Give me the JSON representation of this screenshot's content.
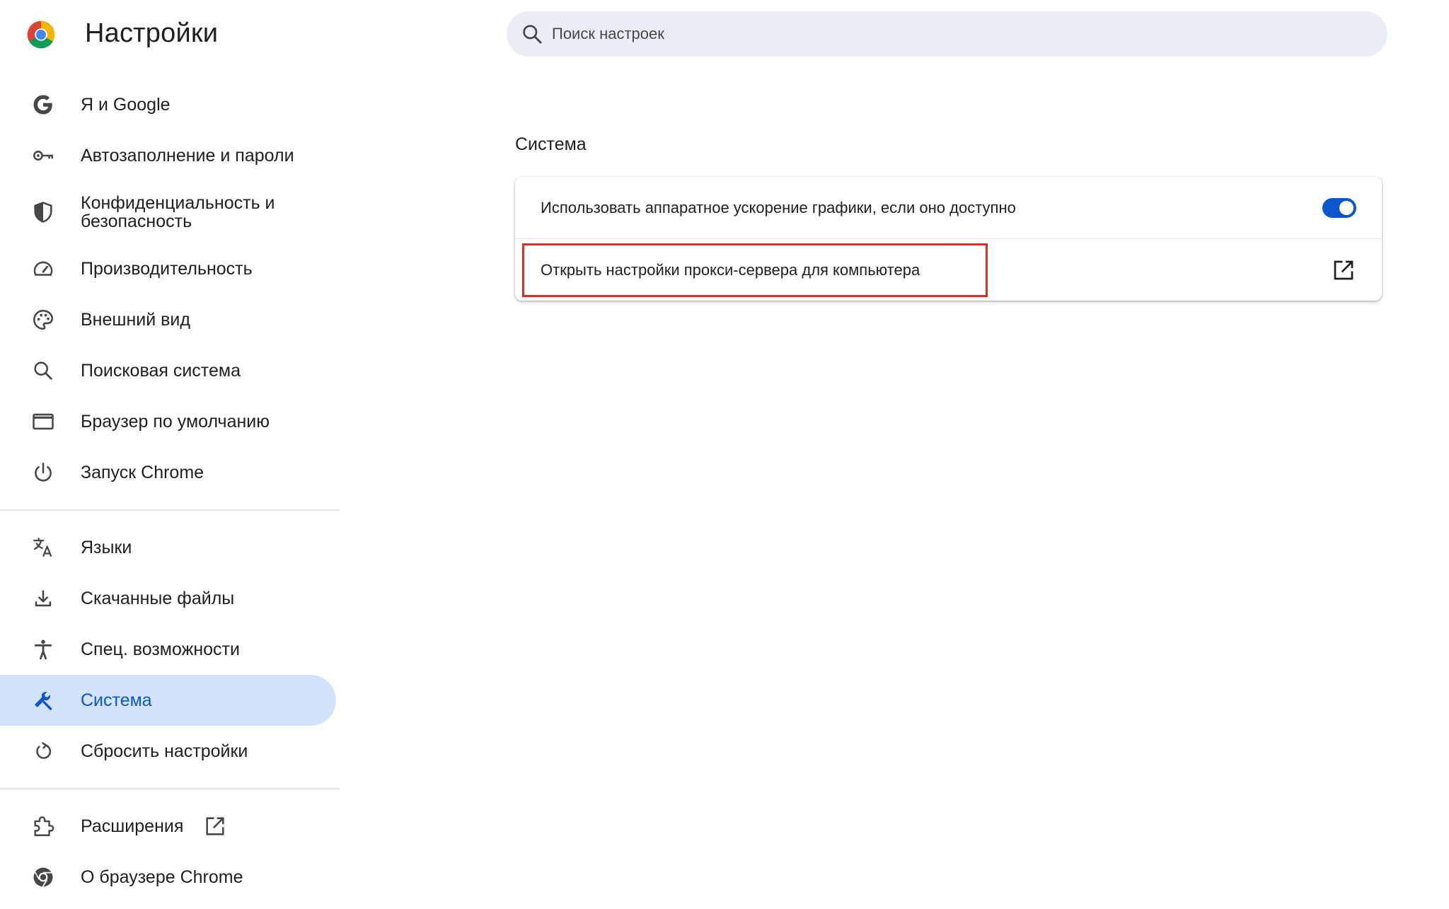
{
  "header": {
    "title": "Настройки",
    "search_placeholder": "Поиск настроек"
  },
  "sidebar": {
    "items": [
      {
        "label": "Я и Google",
        "icon": "google-g-icon"
      },
      {
        "label": "Автозаполнение и пароли",
        "icon": "key-icon"
      },
      {
        "label": "Конфиденциальность и безопасность",
        "icon": "shield-icon"
      },
      {
        "label": "Производительность",
        "icon": "speedometer-icon"
      },
      {
        "label": "Внешний вид",
        "icon": "palette-icon"
      },
      {
        "label": "Поисковая система",
        "icon": "search-icon"
      },
      {
        "label": "Браузер по умолчанию",
        "icon": "browser-window-icon"
      },
      {
        "label": "Запуск Chrome",
        "icon": "power-icon"
      },
      {
        "label": "Языки",
        "icon": "translate-icon"
      },
      {
        "label": "Скачанные файлы",
        "icon": "download-icon"
      },
      {
        "label": "Спец. возможности",
        "icon": "accessibility-icon"
      },
      {
        "label": "Система",
        "icon": "wrench-icon",
        "active": true
      },
      {
        "label": "Сбросить настройки",
        "icon": "reset-icon"
      },
      {
        "label": "Расширения",
        "icon": "puzzle-icon"
      },
      {
        "label": "О браузере Chrome",
        "icon": "chrome-icon"
      }
    ]
  },
  "main": {
    "section_title": "Система",
    "rows": [
      {
        "label": "Использовать аппаратное ускорение графики, если оно доступно",
        "control": "toggle",
        "toggle_on": true
      },
      {
        "label": "Открыть настройки прокси-сервера для компьютера",
        "control": "open-external-icon"
      }
    ]
  },
  "colors": {
    "accent": "#0b57d0",
    "active_bg": "#d3e3fd",
    "search_bg": "#e9eef6",
    "highlight_border": "#d93025"
  }
}
